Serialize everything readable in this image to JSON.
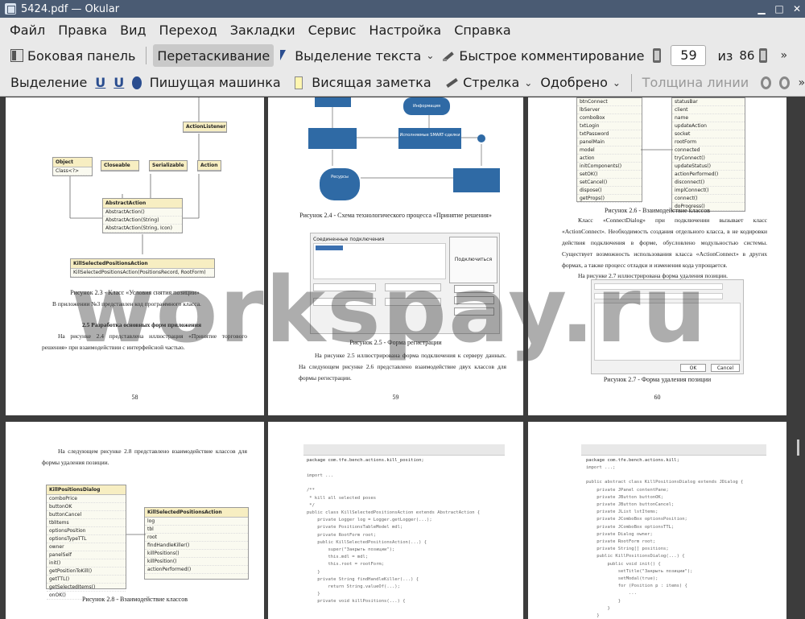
{
  "window": {
    "title": "5424.pdf — Okular"
  },
  "menu": [
    "Файл",
    "Правка",
    "Вид",
    "Переход",
    "Закладки",
    "Сервис",
    "Настройка",
    "Справка"
  ],
  "toolbar1": {
    "sidebar_label": "Боковая панель",
    "drag_label": "Перетаскивание",
    "text_select_label": "Выделение текста",
    "quick_comment_label": "Быстрое комментирование",
    "page_current": "59",
    "of_label": "из",
    "page_total": "86"
  },
  "toolbar2": {
    "highlight_label": "Выделение",
    "u1": "U",
    "u2": "U",
    "typewriter_label": "Пишущая машинка",
    "note_label": "Висящая заметка",
    "arrow_label": "Стрелка",
    "stamp_label": "Одобрено",
    "line_width_label": "Толщина линии"
  },
  "watermark": "workspay.ru",
  "pages": {
    "p58": {
      "caption": "Рисунок 2.3 - Класс «Условия снятия позиции»",
      "line1": "В приложении №3 представлен код программного класса.",
      "heading": "2.5 Разработка основных форм приложения",
      "para": "На рисунке 2.4 представлена иллюстрация «Принятие торгового решения» при взаимодействии с интерфейсной частью.",
      "num": "58",
      "boxes": {
        "object": "Object",
        "closeable": "Closeable",
        "serializable": "Serializable",
        "action": "Action",
        "listener": "ActionListener",
        "abstract": "AbstractAction",
        "kill": "KillSelectedPositionsAction"
      }
    },
    "p59": {
      "caption1": "Рисунок 2.4 - Схема технологического процесса «Принятие решения»",
      "form_title": "Соединенные подключения",
      "connect_btn": "Подключиться",
      "caption2": "Рисунок 2.5 - Форма регистрации",
      "para": "На рисунке 2.5 иллюстрирована форма подключения к серверу данных. На следующем рисунке 2.6 представлено взаимодействие двух классов для формы регистрации.",
      "num": "59",
      "diag_resource": "Ресурсы",
      "diag_decision": "Исполняемые SMART-сделки",
      "diag_info": "Информация"
    },
    "p60": {
      "caption1": "Рисунок 2.6 - Взаимодействие классов",
      "para": "Класс «ConnectDialog» при подключении вызывает класс «ActionConnect». Необходимость создания отдельного класса, в не кодировки действия подключения в форме, обусловлено модульностью системы. Существует возможность использования класса «ActionConnect» в других формах, а также процесс отладки и изменения кода упрощается.",
      "line2": "На рисунке 2.7 иллюстрирована форма удаления позиции.",
      "caption2": "Рисунок 2.7 - Форма удаления позиции",
      "num": "60",
      "ok": "OK",
      "cancel": "Cancel"
    },
    "p61": {
      "para": "На следующем рисунке 2.8 представлено взаимодействие классов для формы удаления позиции.",
      "caption": "Рисунок 2.8 - Взаимодействие классов",
      "box1": "KillPositionsDialog",
      "box2": "KillSelectedPositionsAction"
    },
    "p62": {
      "code_head": "package com.tfe.bench.actions.kill_position;"
    },
    "p63": {
      "code_head": "package com.tfe.bench.actions.kill;"
    }
  }
}
